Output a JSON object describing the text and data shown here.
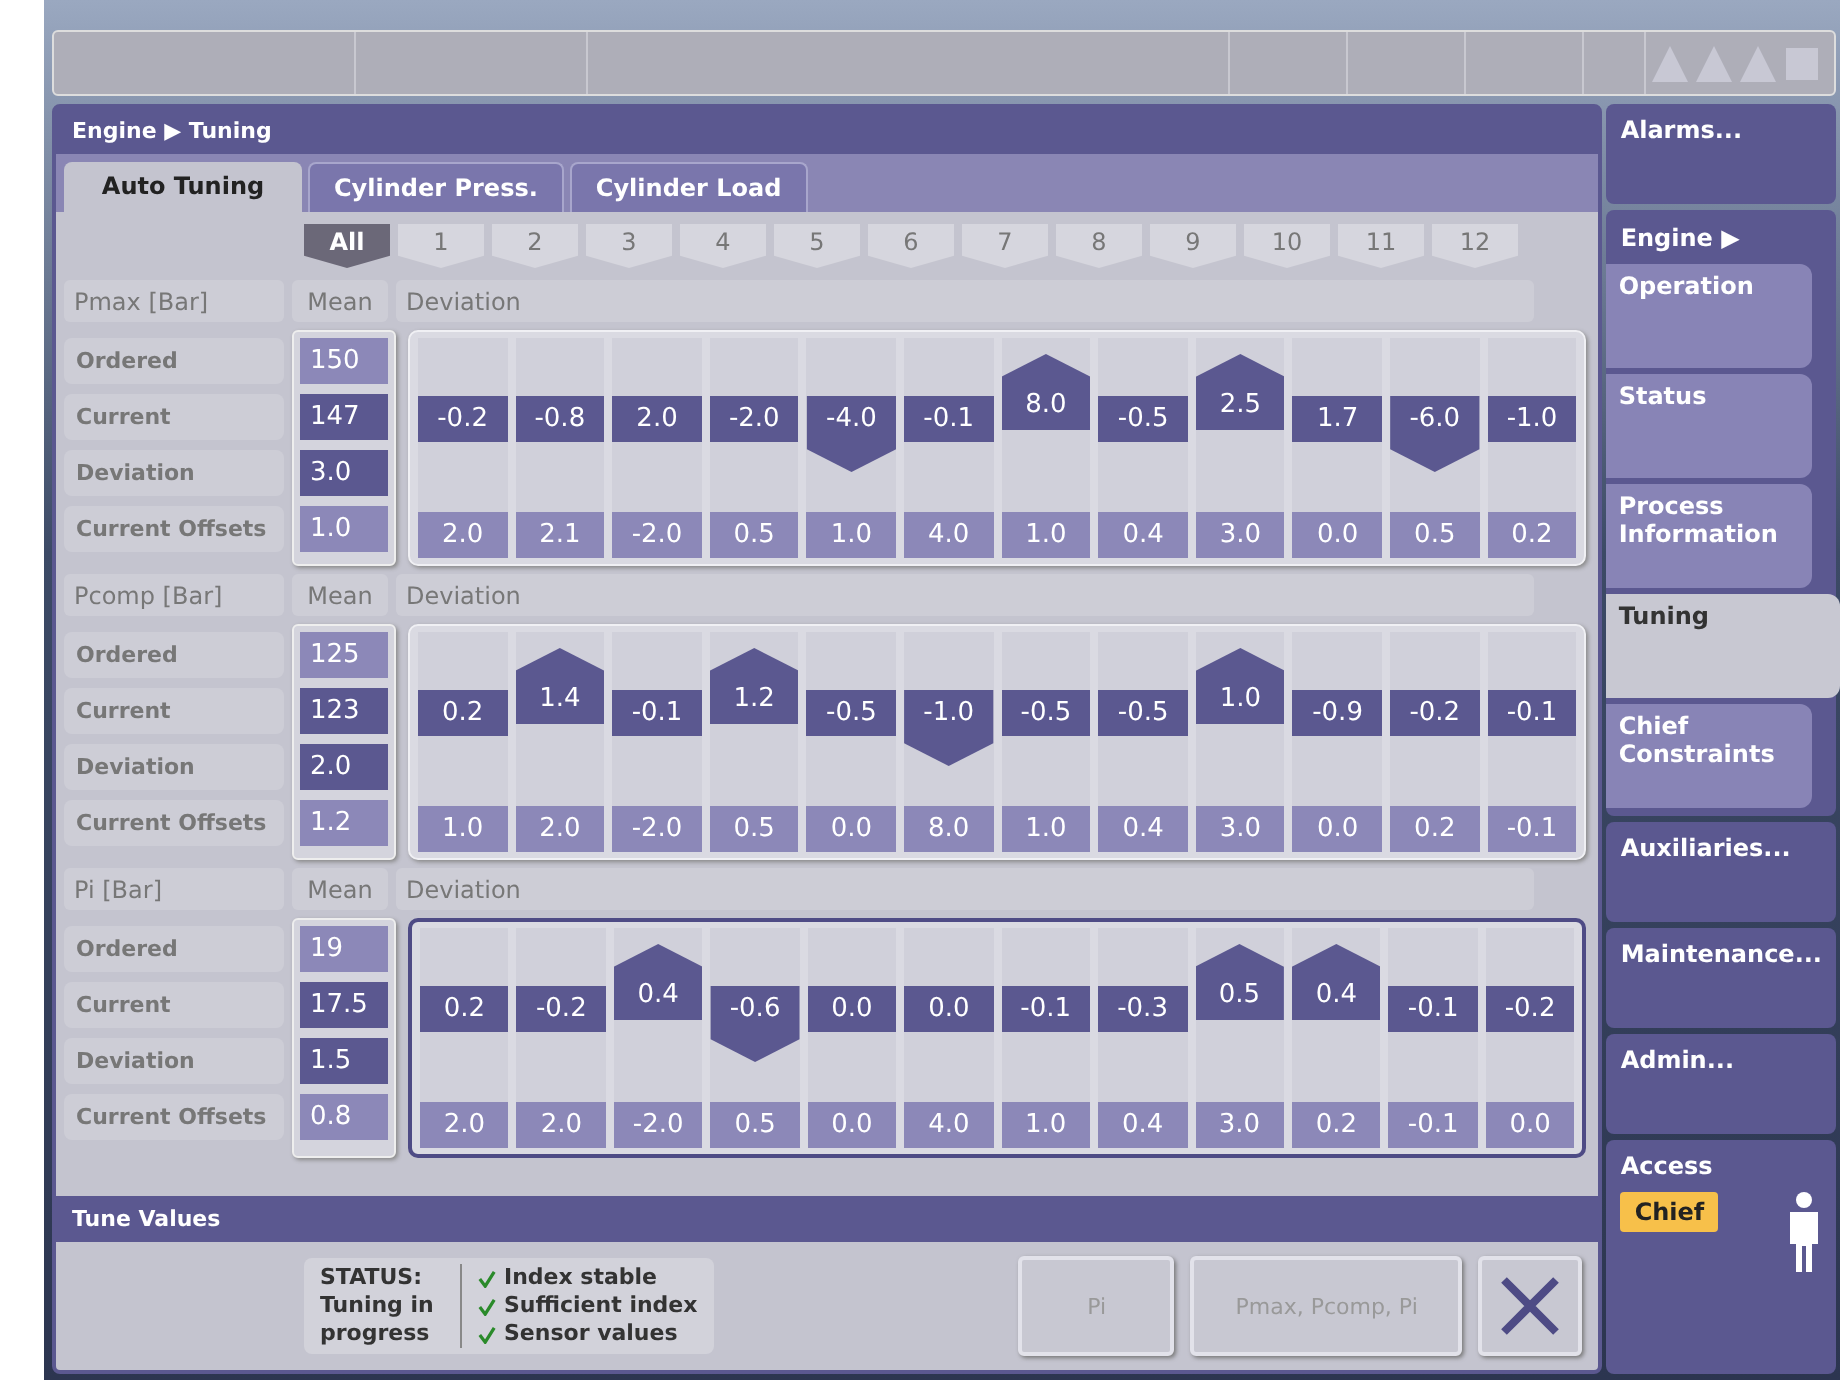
{
  "breadcrumb": "Engine ▶ Tuning",
  "tabs": [
    {
      "label": "Auto Tuning",
      "selected": true
    },
    {
      "label": "Cylinder Press.",
      "selected": false
    },
    {
      "label": "Cylinder Load",
      "selected": false
    }
  ],
  "channels": [
    {
      "label": "All",
      "selected": true
    },
    {
      "label": "1",
      "selected": false
    },
    {
      "label": "2",
      "selected": false
    },
    {
      "label": "3",
      "selected": false
    },
    {
      "label": "4",
      "selected": false
    },
    {
      "label": "5",
      "selected": false
    },
    {
      "label": "6",
      "selected": false
    },
    {
      "label": "7",
      "selected": false
    },
    {
      "label": "8",
      "selected": false
    },
    {
      "label": "9",
      "selected": false
    },
    {
      "label": "10",
      "selected": false
    },
    {
      "label": "11",
      "selected": false
    },
    {
      "label": "12",
      "selected": false
    }
  ],
  "sections": [
    {
      "title": "Pmax [Bar]",
      "mean_label": "Mean",
      "deviation_label": "Deviation",
      "selected": false,
      "rows": [
        {
          "label": "Ordered",
          "mean": "150"
        },
        {
          "label": "Current",
          "mean": "147"
        },
        {
          "label": "Deviation",
          "mean": "3.0"
        },
        {
          "label": "Current Offsets",
          "mean": "1.0"
        }
      ],
      "deviations": [
        {
          "value": "-0.2",
          "kind": "flat"
        },
        {
          "value": "-0.8",
          "kind": "flat"
        },
        {
          "value": "2.0",
          "kind": "flat"
        },
        {
          "value": "-2.0",
          "kind": "flat"
        },
        {
          "value": "-4.0",
          "kind": "down"
        },
        {
          "value": "-0.1",
          "kind": "flat"
        },
        {
          "value": "8.0",
          "kind": "up"
        },
        {
          "value": "-0.5",
          "kind": "flat"
        },
        {
          "value": "2.5",
          "kind": "up"
        },
        {
          "value": "1.7",
          "kind": "flat"
        },
        {
          "value": "-6.0",
          "kind": "down"
        },
        {
          "value": "-1.0",
          "kind": "flat"
        }
      ],
      "offsets": [
        "2.0",
        "2.1",
        "-2.0",
        "0.5",
        "1.0",
        "4.0",
        "1.0",
        "0.4",
        "3.0",
        "0.0",
        "0.5",
        "0.2"
      ]
    },
    {
      "title": "Pcomp [Bar]",
      "mean_label": "Mean",
      "deviation_label": "Deviation",
      "selected": false,
      "rows": [
        {
          "label": "Ordered",
          "mean": "125"
        },
        {
          "label": "Current",
          "mean": "123"
        },
        {
          "label": "Deviation",
          "mean": "2.0"
        },
        {
          "label": "Current Offsets",
          "mean": "1.2"
        }
      ],
      "deviations": [
        {
          "value": "0.2",
          "kind": "flat"
        },
        {
          "value": "1.4",
          "kind": "up"
        },
        {
          "value": "-0.1",
          "kind": "flat"
        },
        {
          "value": "1.2",
          "kind": "up"
        },
        {
          "value": "-0.5",
          "kind": "flat"
        },
        {
          "value": "-1.0",
          "kind": "down"
        },
        {
          "value": "-0.5",
          "kind": "flat"
        },
        {
          "value": "-0.5",
          "kind": "flat"
        },
        {
          "value": "1.0",
          "kind": "up"
        },
        {
          "value": "-0.9",
          "kind": "flat"
        },
        {
          "value": "-0.2",
          "kind": "flat"
        },
        {
          "value": "-0.1",
          "kind": "flat"
        }
      ],
      "offsets": [
        "1.0",
        "2.0",
        "-2.0",
        "0.5",
        "0.0",
        "8.0",
        "1.0",
        "0.4",
        "3.0",
        "0.0",
        "0.2",
        "-0.1"
      ]
    },
    {
      "title": "Pi [Bar]",
      "mean_label": "Mean",
      "deviation_label": "Deviation",
      "selected": true,
      "rows": [
        {
          "label": "Ordered",
          "mean": "19"
        },
        {
          "label": "Current",
          "mean": "17.5"
        },
        {
          "label": "Deviation",
          "mean": "1.5"
        },
        {
          "label": "Current Offsets",
          "mean": "0.8"
        }
      ],
      "deviations": [
        {
          "value": "0.2",
          "kind": "flat"
        },
        {
          "value": "-0.2",
          "kind": "flat"
        },
        {
          "value": "0.4",
          "kind": "up"
        },
        {
          "value": "-0.6",
          "kind": "down"
        },
        {
          "value": "0.0",
          "kind": "flat"
        },
        {
          "value": "0.0",
          "kind": "flat"
        },
        {
          "value": "-0.1",
          "kind": "flat"
        },
        {
          "value": "-0.3",
          "kind": "flat"
        },
        {
          "value": "0.5",
          "kind": "up"
        },
        {
          "value": "0.4",
          "kind": "up"
        },
        {
          "value": "-0.1",
          "kind": "flat"
        },
        {
          "value": "-0.2",
          "kind": "flat"
        }
      ],
      "offsets": [
        "2.0",
        "2.0",
        "-2.0",
        "0.5",
        "0.0",
        "4.0",
        "1.0",
        "0.4",
        "3.0",
        "0.2",
        "-0.1",
        "0.0"
      ]
    }
  ],
  "tune_values": {
    "title": "Tune Values",
    "status_label": "STATUS:",
    "status_text": "Tuning in progress",
    "checks": [
      {
        "label": "Index stable",
        "checked": true
      },
      {
        "label": "Sufficient index",
        "checked": true
      },
      {
        "label": "Sensor values",
        "checked": true
      }
    ],
    "buttons": [
      {
        "label": "Pi",
        "disabled": true
      },
      {
        "label": "Pmax, Pcomp, Pi",
        "disabled": true
      }
    ]
  },
  "nav": [
    {
      "label": "Alarms...",
      "kind": "button"
    },
    {
      "label": "Engine ▶",
      "kind": "group",
      "children": [
        {
          "label": "Operation",
          "selected": false
        },
        {
          "label": "Status",
          "selected": false
        },
        {
          "label": "Process Information",
          "selected": false
        },
        {
          "label": "Tuning",
          "selected": true
        },
        {
          "label": "Chief Constraints",
          "selected": false
        }
      ]
    },
    {
      "label": "Auxiliaries...",
      "kind": "button"
    },
    {
      "label": "Maintenance...",
      "kind": "button"
    },
    {
      "label": "Admin...",
      "kind": "button"
    }
  ],
  "access": {
    "title": "Access",
    "level": "Chief"
  }
}
